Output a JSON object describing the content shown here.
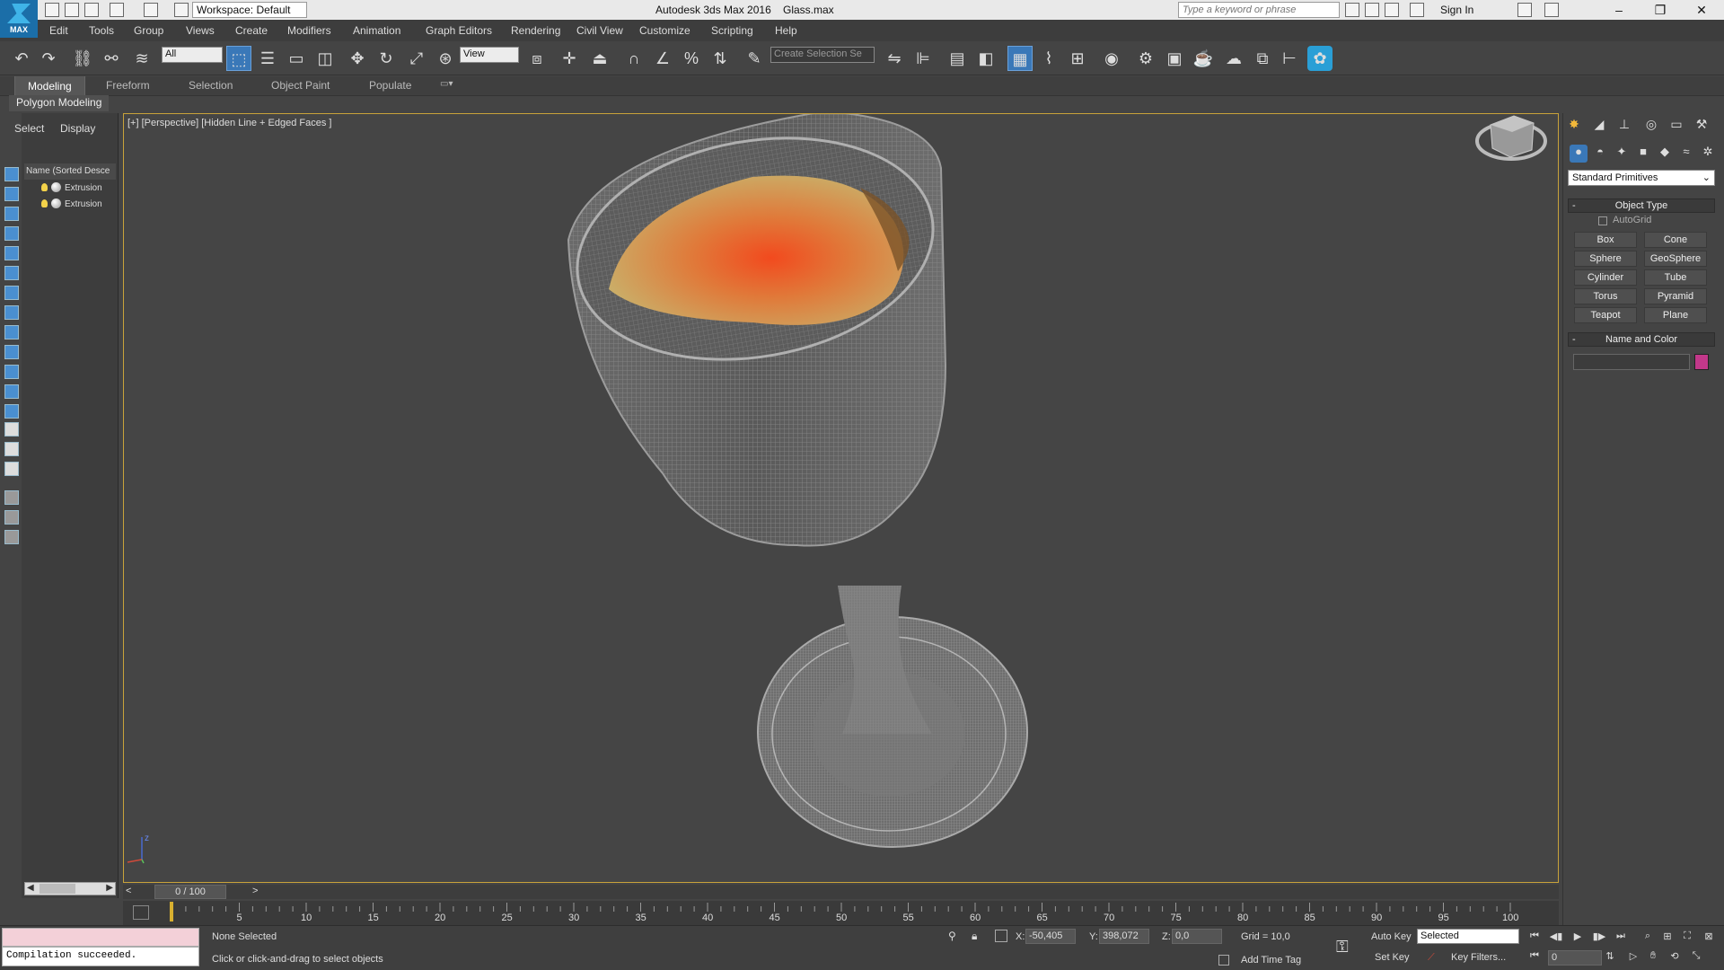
{
  "app": {
    "title": "Autodesk 3ds Max 2016",
    "file": "Glass.max",
    "workspace": "Workspace: Default",
    "search_placeholder": "Type a keyword or phrase",
    "sign_in": "Sign In",
    "logo_text": "MAX"
  },
  "menu": [
    "Edit",
    "Tools",
    "Group",
    "Views",
    "Create",
    "Modifiers",
    "Animation",
    "Graph Editors",
    "Rendering",
    "Civil View",
    "Customize",
    "Scripting",
    "Help"
  ],
  "toolbar": {
    "filter_value": "All",
    "refcoord_value": "View",
    "selection_set_placeholder": "Create Selection Se"
  },
  "ribbon": {
    "tabs": [
      "Modeling",
      "Freeform",
      "Selection",
      "Object Paint",
      "Populate"
    ],
    "active_tab": "Modeling",
    "panel": "Polygon Modeling"
  },
  "explorer": {
    "tabs": [
      "Select",
      "Display"
    ],
    "header": "Name (Sorted Desce",
    "items": [
      "Extrusion",
      "Extrusion"
    ]
  },
  "viewport": {
    "label": "[+] [Perspective] [Hidden Line + Edged Faces ]",
    "axis_label": "z"
  },
  "timeline": {
    "slider": "0 / 100",
    "ticks": [
      "5",
      "10",
      "15",
      "20",
      "25",
      "30",
      "35",
      "40",
      "45",
      "50",
      "55",
      "60",
      "65",
      "70",
      "75",
      "80",
      "85",
      "90",
      "95",
      "100"
    ]
  },
  "status": {
    "maxscript_output": "Compilation succeeded.",
    "selection": "None Selected",
    "prompt": "Click or click-and-drag to select objects",
    "x_label": "X:",
    "x_value": "-50,405",
    "y_label": "Y:",
    "y_value": "398,072",
    "z_label": "Z:",
    "z_value": "0,0",
    "grid": "Grid = 10,0",
    "add_time_tag": "Add Time Tag",
    "auto_key": "Auto Key",
    "set_key": "Set Key",
    "selected_value": "Selected",
    "key_filters": "Key Filters...",
    "frame_value": "0"
  },
  "command_panel": {
    "dropdown": "Standard Primitives",
    "object_type_title": "Object Type",
    "autogrid_label": "AutoGrid",
    "primitives": [
      "Box",
      "Cone",
      "Sphere",
      "GeoSphere",
      "Cylinder",
      "Tube",
      "Torus",
      "Pyramid",
      "Teapot",
      "Plane"
    ],
    "name_color_title": "Name and Color",
    "swatch_color": "#c2388a"
  },
  "colors": {
    "viewport_bg": "#454545",
    "active_border": "#c8a23a",
    "accent_blue": "#3a78b8",
    "liquid_core": "#f24a1e",
    "liquid_edge": "#c9b06a"
  }
}
